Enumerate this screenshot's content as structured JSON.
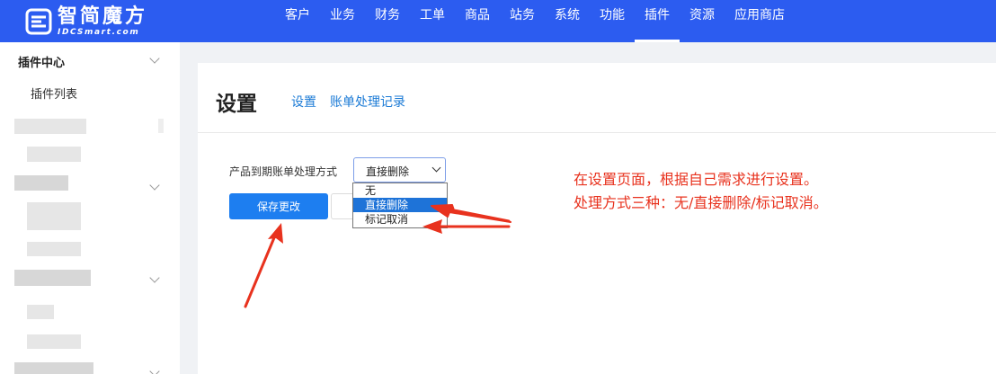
{
  "brand": {
    "name": "智简魔方",
    "tagline": "IDCSmart.com"
  },
  "nav": [
    {
      "label": "客户",
      "active": false
    },
    {
      "label": "业务",
      "active": false
    },
    {
      "label": "财务",
      "active": false
    },
    {
      "label": "工单",
      "active": false
    },
    {
      "label": "商品",
      "active": false
    },
    {
      "label": "站务",
      "active": false
    },
    {
      "label": "系统",
      "active": false
    },
    {
      "label": "功能",
      "active": false
    },
    {
      "label": "插件",
      "active": true
    },
    {
      "label": "资源",
      "active": false
    },
    {
      "label": "应用商店",
      "active": false
    }
  ],
  "sidebar": {
    "group_title": "插件中心",
    "items": [
      {
        "label": "插件列表"
      }
    ]
  },
  "page": {
    "title": "设置",
    "tabs": [
      {
        "label": "设置"
      },
      {
        "label": "账单处理记录"
      }
    ]
  },
  "form": {
    "field_label": "产品到期账单处理方式",
    "selected_value": "直接删除",
    "options": [
      {
        "label": "无",
        "selected": false
      },
      {
        "label": "直接删除",
        "selected": true
      },
      {
        "label": "标记取消",
        "selected": false
      }
    ],
    "save_label": "保存更改"
  },
  "annotation": {
    "line1": "在设置页面，根据自己需求进行设置。",
    "line2": "处理方式三种：无/直接删除/标记取消。",
    "color": "#e8321e"
  },
  "colors": {
    "header": "#2c5cf0",
    "primary": "#1d7ef0",
    "link": "#1c7bd6"
  }
}
